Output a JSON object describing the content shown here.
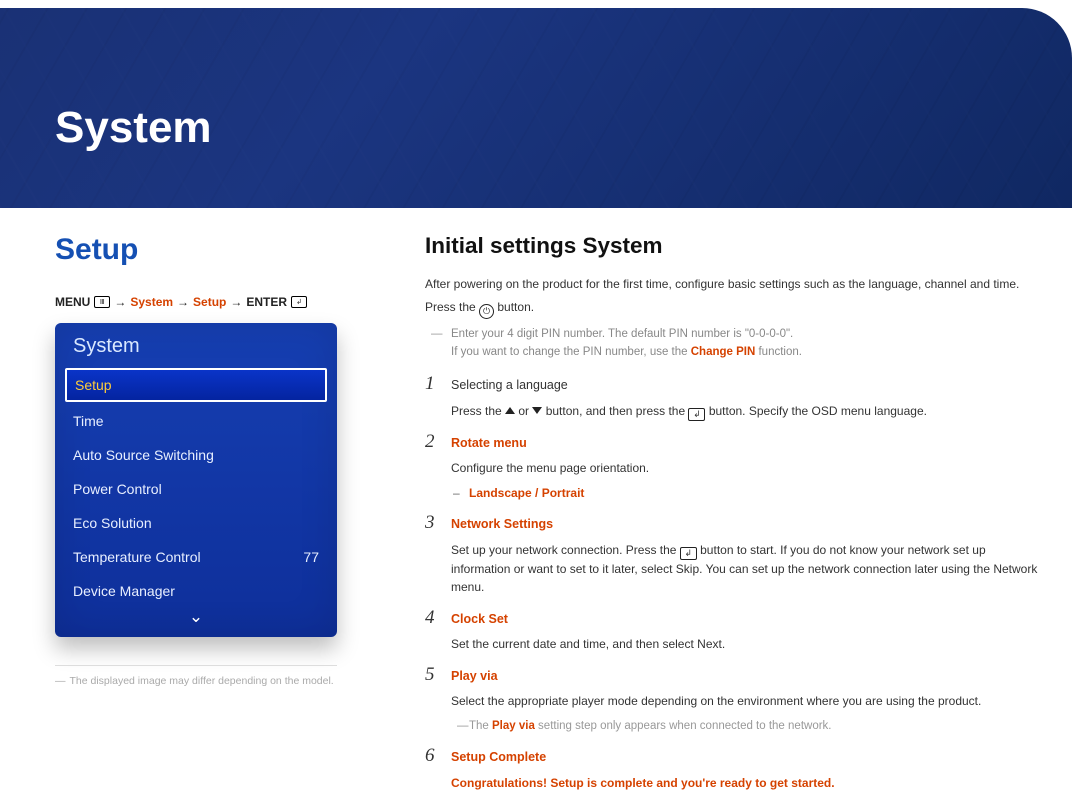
{
  "banner": {
    "title": "System"
  },
  "left": {
    "heading": "Setup",
    "breadcrumb": {
      "menu": "MENU",
      "arrow": "→",
      "system": "System",
      "setup": "Setup",
      "enter": "ENTER"
    },
    "osd": {
      "title": "System",
      "items": [
        {
          "label": "Setup",
          "selected": true
        },
        {
          "label": "Time"
        },
        {
          "label": "Auto Source Switching"
        },
        {
          "label": "Power Control"
        },
        {
          "label": "Eco Solution"
        },
        {
          "label": "Temperature Control",
          "value": "77"
        },
        {
          "label": "Device Manager"
        }
      ]
    },
    "footnote": "The displayed image may differ depending on the model."
  },
  "right": {
    "heading": "Initial settings System",
    "intro1": "After powering on the product for the first time, configure basic settings such as the language, channel and time.",
    "intro2a": "Press the ",
    "intro2b": " button.",
    "note1a": "Enter your 4 digit PIN number. The default PIN number is \"0-0-0-0\".",
    "note1b_a": "If you want to change the PIN number, use the ",
    "note1b_accent": "Change PIN",
    "note1b_c": " function.",
    "steps": {
      "s1_title": "Selecting a language",
      "s1_body_a": "Press the ",
      "s1_body_b": " or ",
      "s1_body_c": " button, and then press the ",
      "s1_body_d": " button. Specify the OSD menu language.",
      "s2_title": "Rotate menu",
      "s2_body": "Configure the menu page orientation.",
      "s2_opt_a": "Landscape",
      "s2_sep": " / ",
      "s2_opt_b": "Portrait",
      "s3_title": "Network Settings",
      "s3_body_a": "Set up your network connection. Press the ",
      "s3_body_b": " button to start. If you do not know your network set up information or want to set to it later, select ",
      "s3_skip": "Skip",
      "s3_body_c": ". You can set up the network connection later using the ",
      "s3_network": "Network",
      "s3_body_d": " menu.",
      "s4_title": "Clock Set",
      "s4_body_a": "Set the current date and time, and then select ",
      "s4_next": "Next",
      "s4_body_b": ".",
      "s5_title": "Play via",
      "s5_body": "Select the appropriate player mode depending on the environment where you are using the product.",
      "s5_note_a": "The ",
      "s5_note_accent": "Play via",
      "s5_note_b": " setting step only appears when connected to the network.",
      "s6_title": "Setup Complete",
      "s6_congrats": "Congratulations! Setup is complete and you're ready to get started."
    }
  }
}
